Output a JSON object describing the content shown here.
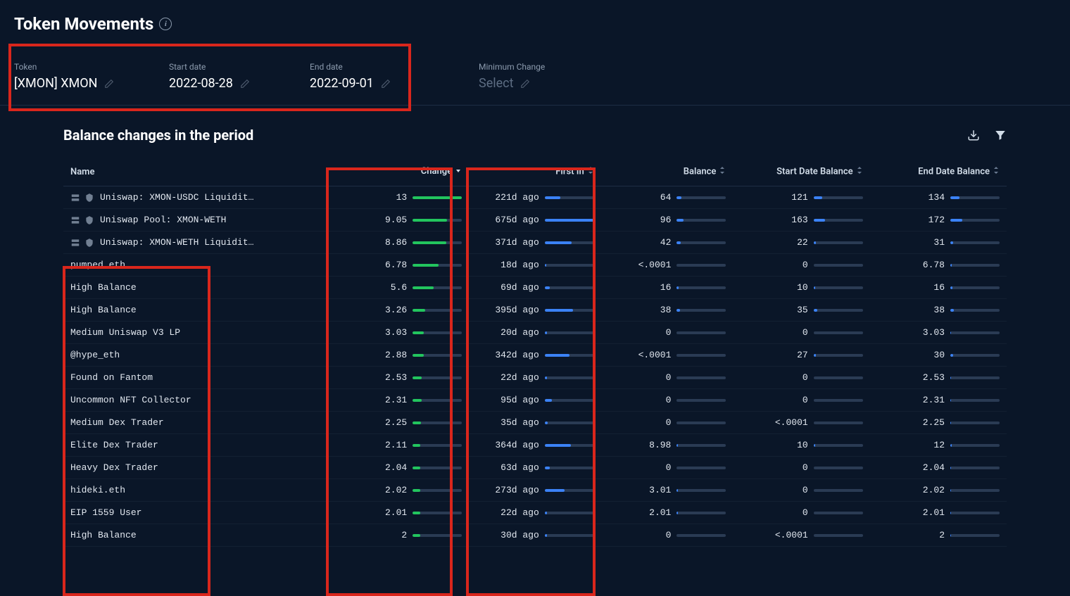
{
  "header": {
    "title": "Token Movements"
  },
  "filters": {
    "token": {
      "label": "Token",
      "value": "[XMON] XMON"
    },
    "start_date": {
      "label": "Start date",
      "value": "2022-08-28"
    },
    "end_date": {
      "label": "End date",
      "value": "2022-09-01"
    },
    "min_change": {
      "label": "Minimum Change",
      "value": "Select"
    }
  },
  "section": {
    "title": "Balance changes in the period"
  },
  "columns": {
    "name": "Name",
    "change": "Change",
    "first_in": "First In",
    "balance": "Balance",
    "start_balance": "Start Date Balance",
    "end_balance": "End Date Balance"
  },
  "rows": [
    {
      "name": "Uniswap: XMON-USDC Liquidit…",
      "has_icons": true,
      "change": "13",
      "change_pct": 100,
      "first_in": "221d ago",
      "first_in_pct": 32,
      "balance": "64",
      "balance_pct": 10,
      "start_balance": "121",
      "start_balance_pct": 18,
      "end_balance": "134",
      "end_balance_pct": 18
    },
    {
      "name": "Uniswap Pool: XMON-WETH",
      "has_icons": true,
      "change": "9.05",
      "change_pct": 70,
      "first_in": "675d ago",
      "first_in_pct": 100,
      "balance": "96",
      "balance_pct": 14,
      "start_balance": "163",
      "start_balance_pct": 24,
      "end_balance": "172",
      "end_balance_pct": 24
    },
    {
      "name": "Uniswap: XMON-WETH Liquidit…",
      "has_icons": true,
      "change": "8.86",
      "change_pct": 68,
      "first_in": "371d ago",
      "first_in_pct": 54,
      "balance": "42",
      "balance_pct": 8,
      "start_balance": "22",
      "start_balance_pct": 5,
      "end_balance": "31",
      "end_balance_pct": 6
    },
    {
      "name": "pumped.eth",
      "has_icons": false,
      "change": "6.78",
      "change_pct": 52,
      "first_in": "18d ago",
      "first_in_pct": 3,
      "balance": "<.0001",
      "balance_pct": 0,
      "start_balance": "0",
      "start_balance_pct": 0,
      "end_balance": "6.78",
      "end_balance_pct": 3
    },
    {
      "name": "High Balance",
      "has_icons": false,
      "change": "5.6",
      "change_pct": 43,
      "first_in": "69d ago",
      "first_in_pct": 10,
      "balance": "16",
      "balance_pct": 4,
      "start_balance": "10",
      "start_balance_pct": 3,
      "end_balance": "16",
      "end_balance_pct": 4
    },
    {
      "name": "High Balance",
      "has_icons": false,
      "change": "3.26",
      "change_pct": 25,
      "first_in": "395d ago",
      "first_in_pct": 58,
      "balance": "38",
      "balance_pct": 7,
      "start_balance": "35",
      "start_balance_pct": 7,
      "end_balance": "38",
      "end_balance_pct": 7
    },
    {
      "name": "Medium Uniswap V3 LP",
      "has_icons": false,
      "change": "3.03",
      "change_pct": 23,
      "first_in": "20d ago",
      "first_in_pct": 4,
      "balance": "0",
      "balance_pct": 0,
      "start_balance": "0",
      "start_balance_pct": 0,
      "end_balance": "3.03",
      "end_balance_pct": 2
    },
    {
      "name": "@hype_eth",
      "has_icons": false,
      "change": "2.88",
      "change_pct": 22,
      "first_in": "342d ago",
      "first_in_pct": 50,
      "balance": "<.0001",
      "balance_pct": 0,
      "start_balance": "27",
      "start_balance_pct": 5,
      "end_balance": "30",
      "end_balance_pct": 6
    },
    {
      "name": "Found on Fantom",
      "has_icons": false,
      "change": "2.53",
      "change_pct": 19,
      "first_in": "22d ago",
      "first_in_pct": 4,
      "balance": "0",
      "balance_pct": 0,
      "start_balance": "0",
      "start_balance_pct": 0,
      "end_balance": "2.53",
      "end_balance_pct": 2
    },
    {
      "name": "Uncommon NFT Collector",
      "has_icons": false,
      "change": "2.31",
      "change_pct": 18,
      "first_in": "95d ago",
      "first_in_pct": 14,
      "balance": "0",
      "balance_pct": 0,
      "start_balance": "0",
      "start_balance_pct": 0,
      "end_balance": "2.31",
      "end_balance_pct": 2
    },
    {
      "name": "Medium Dex Trader",
      "has_icons": false,
      "change": "2.25",
      "change_pct": 17,
      "first_in": "35d ago",
      "first_in_pct": 6,
      "balance": "0",
      "balance_pct": 0,
      "start_balance": "<.0001",
      "start_balance_pct": 0,
      "end_balance": "2.25",
      "end_balance_pct": 2
    },
    {
      "name": "Elite Dex Trader",
      "has_icons": false,
      "change": "2.11",
      "change_pct": 16,
      "first_in": "364d ago",
      "first_in_pct": 53,
      "balance": "8.98",
      "balance_pct": 3,
      "start_balance": "10",
      "start_balance_pct": 3,
      "end_balance": "12",
      "end_balance_pct": 3
    },
    {
      "name": "Heavy Dex Trader",
      "has_icons": false,
      "change": "2.04",
      "change_pct": 16,
      "first_in": "63d ago",
      "first_in_pct": 10,
      "balance": "0",
      "balance_pct": 0,
      "start_balance": "0",
      "start_balance_pct": 0,
      "end_balance": "2.04",
      "end_balance_pct": 2
    },
    {
      "name": "hideki.eth",
      "has_icons": false,
      "change": "2.02",
      "change_pct": 16,
      "first_in": "273d ago",
      "first_in_pct": 40,
      "balance": "3.01",
      "balance_pct": 2,
      "start_balance": "0",
      "start_balance_pct": 0,
      "end_balance": "2.02",
      "end_balance_pct": 2
    },
    {
      "name": "EIP 1559 User",
      "has_icons": false,
      "change": "2.01",
      "change_pct": 15,
      "first_in": "22d ago",
      "first_in_pct": 4,
      "balance": "2.01",
      "balance_pct": 2,
      "start_balance": "0",
      "start_balance_pct": 0,
      "end_balance": "2.01",
      "end_balance_pct": 2
    },
    {
      "name": "High Balance",
      "has_icons": false,
      "change": "2",
      "change_pct": 15,
      "first_in": "30d ago",
      "first_in_pct": 5,
      "balance": "0",
      "balance_pct": 0,
      "start_balance": "<.0001",
      "start_balance_pct": 0,
      "end_balance": "2",
      "end_balance_pct": 2
    }
  ]
}
